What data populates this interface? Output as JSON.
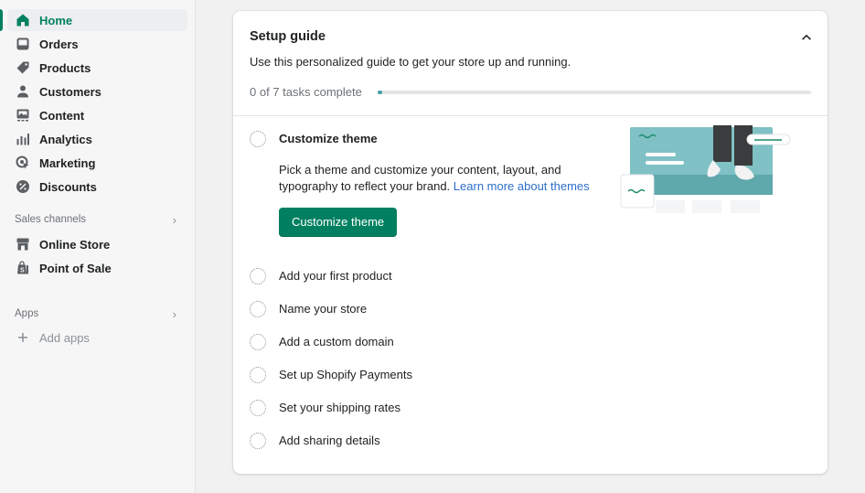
{
  "sidebar": {
    "items": [
      {
        "label": "Home",
        "icon": "home-icon",
        "active": true
      },
      {
        "label": "Orders",
        "icon": "inbox-icon"
      },
      {
        "label": "Products",
        "icon": "tag-icon"
      },
      {
        "label": "Customers",
        "icon": "person-icon"
      },
      {
        "label": "Content",
        "icon": "image-icon"
      },
      {
        "label": "Analytics",
        "icon": "bar-chart-icon"
      },
      {
        "label": "Marketing",
        "icon": "target-icon"
      },
      {
        "label": "Discounts",
        "icon": "percent-badge-icon"
      }
    ],
    "sales_channels": {
      "heading": "Sales channels",
      "items": [
        {
          "label": "Online Store",
          "icon": "store-icon"
        },
        {
          "label": "Point of Sale",
          "icon": "shopping-bag-icon"
        }
      ]
    },
    "apps": {
      "heading": "Apps",
      "add_label": "Add apps"
    }
  },
  "setup_guide": {
    "title": "Setup guide",
    "subtitle": "Use this personalized guide to get your store up and running.",
    "progress_label": "0 of 7 tasks complete",
    "progress_completed": 0,
    "progress_total": 7,
    "accent_color": "#008060",
    "expanded_task": {
      "label": "Customize theme",
      "description": "Pick a theme and customize your content, layout, and typography to reflect your brand.",
      "link_text": "Learn more about themes",
      "button_label": "Customize theme"
    },
    "tasks": [
      "Add your first product",
      "Name your store",
      "Add a custom domain",
      "Set up Shopify Payments",
      "Set your shipping rates",
      "Add sharing details"
    ]
  }
}
